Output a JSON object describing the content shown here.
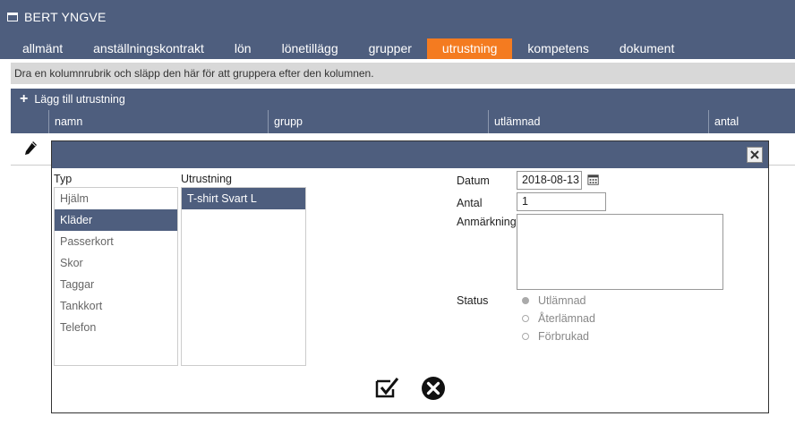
{
  "window": {
    "title": "BERT YNGVE",
    "icon": "window-icon"
  },
  "tabs": [
    {
      "label": "allmänt",
      "active": false
    },
    {
      "label": "anställningskontrakt",
      "active": false
    },
    {
      "label": "lön",
      "active": false
    },
    {
      "label": "lönetillägg",
      "active": false
    },
    {
      "label": "grupper",
      "active": false
    },
    {
      "label": "utrustning",
      "active": true
    },
    {
      "label": "kompetens",
      "active": false
    },
    {
      "label": "dokument",
      "active": false
    }
  ],
  "grid": {
    "group_hint": "Dra en kolumnrubrik och släpp den här för att gruppera efter den kolumnen.",
    "add_label": "Lägg till utrustning",
    "columns": [
      "namn",
      "grupp",
      "utlämnad",
      "antal"
    ],
    "row_icon": "pencil-icon"
  },
  "dialog": {
    "type_label": "Typ",
    "types": [
      {
        "label": "Hjälm",
        "selected": false
      },
      {
        "label": "Kläder",
        "selected": true
      },
      {
        "label": "Passerkort",
        "selected": false
      },
      {
        "label": "Skor",
        "selected": false
      },
      {
        "label": "Taggar",
        "selected": false
      },
      {
        "label": "Tankkort",
        "selected": false
      },
      {
        "label": "Telefon",
        "selected": false
      }
    ],
    "equipment_label": "Utrustning",
    "equipment": [
      {
        "label": "T-shirt Svart L",
        "selected": true
      }
    ],
    "date_label": "Datum",
    "date_value": "2018-08-13",
    "count_label": "Antal",
    "count_value": "1",
    "remark_label": "Anmärkning",
    "remark_value": "",
    "status_label": "Status",
    "status_options": [
      {
        "label": "Utlämnad",
        "checked": true
      },
      {
        "label": "Återlämnad",
        "checked": false
      },
      {
        "label": "Förbrukad",
        "checked": false
      }
    ]
  },
  "colors": {
    "header": "#4e5e7e",
    "accent": "#f47b20",
    "hint_bg": "#d8d8d8"
  }
}
